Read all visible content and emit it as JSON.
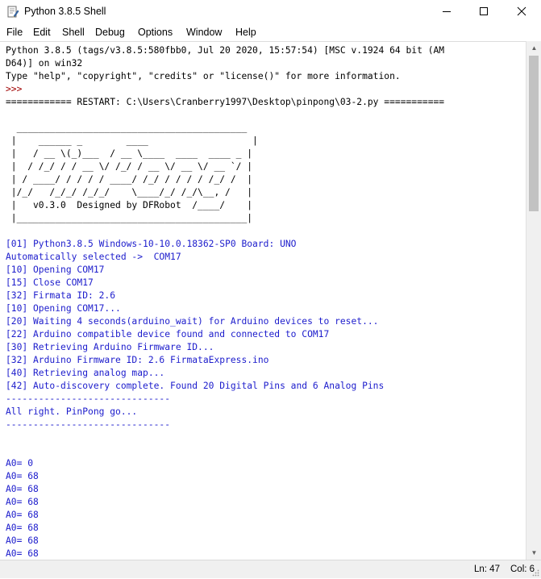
{
  "window": {
    "title": "Python 3.8.5 Shell",
    "icons": [
      "python-shell-icon",
      "minimize-icon",
      "maximize-icon",
      "close-icon"
    ]
  },
  "menu": {
    "items": [
      "File",
      "Edit",
      "Shell",
      "Debug",
      "Options",
      "Window",
      "Help"
    ]
  },
  "shell": {
    "lines": [
      {
        "text": "Python 3.8.5 (tags/v3.8.5:580fbb0, Jul 20 2020, 15:57:54) [MSC v.1924 64 bit (AM",
        "style": "plain"
      },
      {
        "text": "D64)] on win32",
        "style": "plain"
      },
      {
        "text": "Type \"help\", \"copyright\", \"credits\" or \"license()\" for more information.",
        "style": "plain"
      },
      {
        "text": ">>> ",
        "style": "prompt"
      },
      {
        "text": "============ RESTART: C:\\Users\\Cranberry1997\\Desktop\\pinpong\\03-2.py ===========",
        "style": "plain"
      },
      {
        "text": "",
        "style": "plain"
      },
      {
        "text": "  __________________________________________",
        "style": "plain"
      },
      {
        "text": " |    ______ _        ____                   |",
        "style": "plain"
      },
      {
        "text": " |   / __ \\(_)___  / __ \\____  ____  ____ _ |",
        "style": "plain"
      },
      {
        "text": " |  / /_/ / / __ \\/ /_/ / __ \\/ __ \\/ __ `/ |",
        "style": "plain"
      },
      {
        "text": " | / ____/ / / / / ____/ /_/ / / / / /_/ /  |",
        "style": "plain"
      },
      {
        "text": " |/_/   /_/_/ /_/_/    \\____/_/ /_/\\__, /   |",
        "style": "plain"
      },
      {
        "text": " |   v0.3.0  Designed by DFRobot  /____/    |",
        "style": "plain"
      },
      {
        "text": " |__________________________________________|",
        "style": "plain"
      },
      {
        "text": "",
        "style": "plain"
      },
      {
        "text": "[01] Python3.8.5 Windows-10-10.0.18362-SP0 Board: UNO",
        "style": "blue"
      },
      {
        "text": "Automatically selected ->  COM17",
        "style": "blue"
      },
      {
        "text": "[10] Opening COM17",
        "style": "blue"
      },
      {
        "text": "[15] Close COM17",
        "style": "blue"
      },
      {
        "text": "[32] Firmata ID: 2.6",
        "style": "blue"
      },
      {
        "text": "[10] Opening COM17...",
        "style": "blue"
      },
      {
        "text": "[20] Waiting 4 seconds(arduino_wait) for Arduino devices to reset...",
        "style": "blue"
      },
      {
        "text": "[22] Arduino compatible device found and connected to COM17",
        "style": "blue"
      },
      {
        "text": "[30] Retrieving Arduino Firmware ID...",
        "style": "blue"
      },
      {
        "text": "[32] Arduino Firmware ID: 2.6 FirmataExpress.ino",
        "style": "blue"
      },
      {
        "text": "[40] Retrieving analog map...",
        "style": "blue"
      },
      {
        "text": "[42] Auto-discovery complete. Found 20 Digital Pins and 6 Analog Pins",
        "style": "blue"
      },
      {
        "text": "------------------------------",
        "style": "blue"
      },
      {
        "text": "All right. PinPong go...",
        "style": "blue"
      },
      {
        "text": "------------------------------",
        "style": "blue"
      },
      {
        "text": "",
        "style": "blue"
      },
      {
        "text": "",
        "style": "blue"
      },
      {
        "text": "A0= 0",
        "style": "blue"
      },
      {
        "text": "A0= 68",
        "style": "blue"
      },
      {
        "text": "A0= 68",
        "style": "blue"
      },
      {
        "text": "A0= 68",
        "style": "blue"
      },
      {
        "text": "A0= 68",
        "style": "blue"
      },
      {
        "text": "A0= 68",
        "style": "blue"
      },
      {
        "text": "A0= 68",
        "style": "blue"
      },
      {
        "text": "A0= 68",
        "style": "blue"
      },
      {
        "text": "A0= 68",
        "style": "blue"
      }
    ]
  },
  "status": {
    "line": "Ln: 47",
    "col": "Col: 6"
  },
  "colors": {
    "output_blue": "#1c1ccc",
    "prompt_red": "#a00000",
    "text_black": "#000000"
  }
}
